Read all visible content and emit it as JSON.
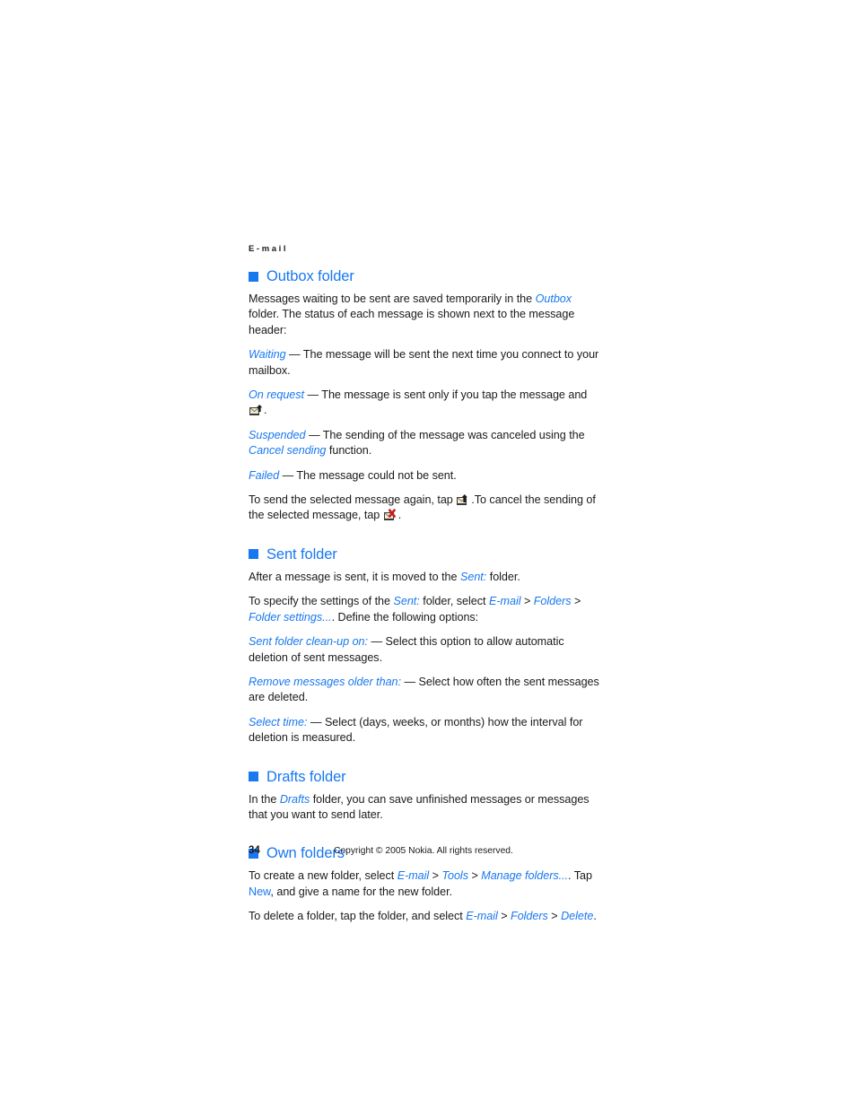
{
  "running_header": "E-mail",
  "sections": [
    {
      "heading": "Outbox folder",
      "paragraphs": {
        "intro_a": "Messages waiting to be sent are saved temporarily in the ",
        "intro_outbox": "Outbox",
        "intro_b": " folder. The status of each message is shown next to the message header:",
        "waiting_term": "Waiting",
        "waiting_desc": " — The message will be sent the next time you connect to your mailbox.",
        "onrequest_term": "On request",
        "onrequest_desc_a": " — The message is sent only if you tap the message and ",
        "onrequest_desc_b": ".",
        "suspended_term": "Suspended",
        "suspended_desc_a": " — The sending of the message was canceled using the ",
        "suspended_cancel": "Cancel sending",
        "suspended_desc_b": " function.",
        "failed_term": "Failed",
        "failed_desc": " — The message could not be sent.",
        "send_again_a": "To send the selected message again, tap ",
        "send_again_b": ".To cancel the sending of the selected message, tap ",
        "send_again_c": "."
      }
    },
    {
      "heading": "Sent folder",
      "paragraphs": {
        "moved_a": "After a message is sent, it is moved to the ",
        "moved_sent": "Sent:",
        "moved_b": " folder.",
        "specify_a": "To specify the settings of the ",
        "specify_sent": "Sent:",
        "specify_b": " folder, select ",
        "specify_email": "E-mail",
        "specify_gt1": " > ",
        "specify_folders": "Folders",
        "specify_gt2": " > ",
        "specify_foldersettings": "Folder settings...",
        "specify_c": ". Define the following options:",
        "cleanup_term": "Sent folder clean-up on:",
        "cleanup_desc": " — Select this option to allow automatic deletion of sent messages.",
        "remove_term": "Remove messages older than:",
        "remove_desc": " — Select how often the sent messages are deleted.",
        "selecttime_term": "Select time:",
        "selecttime_desc": " — Select (days, weeks, or months) how the interval for deletion is measured."
      }
    },
    {
      "heading": "Drafts folder",
      "paragraphs": {
        "drafts_a": "In the ",
        "drafts_term": "Drafts",
        "drafts_b": " folder, you can save unfinished messages or messages that you want to send later."
      }
    },
    {
      "heading": "Own folders",
      "paragraphs": {
        "create_a": "To create a new folder, select ",
        "create_email": "E-mail",
        "create_gt1": " > ",
        "create_tools": "Tools",
        "create_gt2": " > ",
        "create_manage": "Manage folders...",
        "create_b": ". Tap ",
        "create_new": "New",
        "create_c": ", and give a name for the new folder.",
        "delete_a": "To delete a folder, tap the folder, and select ",
        "delete_email": "E-mail",
        "delete_gt1": " > ",
        "delete_folders": "Folders",
        "delete_gt2": " > ",
        "delete_delete": "Delete",
        "delete_b": "."
      }
    }
  ],
  "icons": {
    "send_message": "envelope-up-arrow-icon",
    "cancel_sending": "envelope-red-x-icon"
  },
  "footer": {
    "page_number": "34",
    "copyright": "Copyright © 2005 Nokia. All rights reserved."
  },
  "colors": {
    "accent_blue": "#1878f0",
    "body_text": "#1a1a1a",
    "background": "#ffffff"
  }
}
